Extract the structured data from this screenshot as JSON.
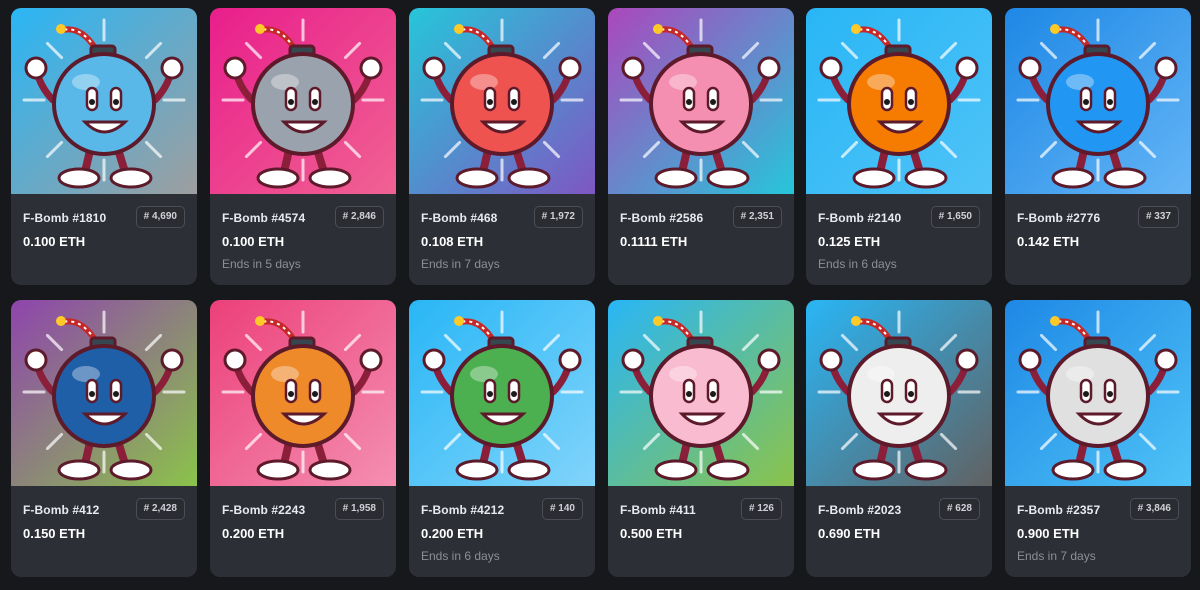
{
  "cards": [
    {
      "name": "F-Bomb #1810",
      "rank": "# 4,690",
      "price": "0.100 ETH",
      "ends": "",
      "bg1": "#29b6f6",
      "bg2": "#9e9e9e",
      "body": "#5ab8e8",
      "icon": "bomb-character-globe-icon"
    },
    {
      "name": "F-Bomb #4574",
      "rank": "# 2,846",
      "price": "0.100 ETH",
      "ends": "Ends in 5 days",
      "bg1": "#e91e8c",
      "bg2": "#f06292",
      "body": "#9aa3ad",
      "icon": "bomb-character-bazooka-icon"
    },
    {
      "name": "F-Bomb #468",
      "rank": "# 1,972",
      "price": "0.108 ETH",
      "ends": "Ends in 7 days",
      "bg1": "#26c6da",
      "bg2": "#7e57c2",
      "body": "#ef5350",
      "icon": "bomb-character-monocle-icon"
    },
    {
      "name": "F-Bomb #2586",
      "rank": "# 2,351",
      "price": "0.1111 ETH",
      "ends": "",
      "bg1": "#ab47bc",
      "bg2": "#26c6da",
      "body": "#f48fb1",
      "icon": "bomb-character-brain-icon"
    },
    {
      "name": "F-Bomb #2140",
      "rank": "# 1,650",
      "price": "0.125 ETH",
      "ends": "Ends in 6 days",
      "bg1": "#29b6f6",
      "bg2": "#4fc3f7",
      "body": "#f57c00",
      "icon": "bomb-character-claws-icon"
    },
    {
      "name": "F-Bomb #2776",
      "rank": "# 337",
      "price": "0.142 ETH",
      "ends": "",
      "bg1": "#1e88e5",
      "bg2": "#64b5f6",
      "body": "#2196f3",
      "icon": "bomb-character-plaid-icon"
    },
    {
      "name": "F-Bomb #412",
      "rank": "# 2,428",
      "price": "0.150 ETH",
      "ends": "",
      "bg1": "#8e44ad",
      "bg2": "#8bc34a",
      "body": "#1e5fa8",
      "icon": "bomb-character-shield-icon"
    },
    {
      "name": "F-Bomb #2243",
      "rank": "# 1,958",
      "price": "0.200 ETH",
      "ends": "",
      "bg1": "#ec407a",
      "bg2": "#f48fb1",
      "body": "#ef8a2a",
      "icon": "bomb-character-mushroom-icon"
    },
    {
      "name": "F-Bomb #4212",
      "rank": "# 140",
      "price": "0.200 ETH",
      "ends": "Ends in 6 days",
      "bg1": "#29b6f6",
      "bg2": "#81d4fa",
      "body": "#4caf50",
      "icon": "bomb-character-earth-icon"
    },
    {
      "name": "F-Bomb #411",
      "rank": "# 126",
      "price": "0.500 ETH",
      "ends": "",
      "bg1": "#29b6f6",
      "bg2": "#8bc34a",
      "body": "#f8bbd0",
      "icon": "bomb-character-mohawk-icon"
    },
    {
      "name": "F-Bomb #2023",
      "rank": "# 628",
      "price": "0.690 ETH",
      "ends": "",
      "bg1": "#29b6f6",
      "bg2": "#616161",
      "body": "#eeeeee",
      "icon": "bomb-character-clown-icon"
    },
    {
      "name": "F-Bomb #2357",
      "rank": "# 3,846",
      "price": "0.900 ETH",
      "ends": "Ends in 7 days",
      "bg1": "#1e88e5",
      "bg2": "#4fc3f7",
      "body": "#e0e0e0",
      "icon": "bomb-character-cleaver-icon"
    }
  ]
}
